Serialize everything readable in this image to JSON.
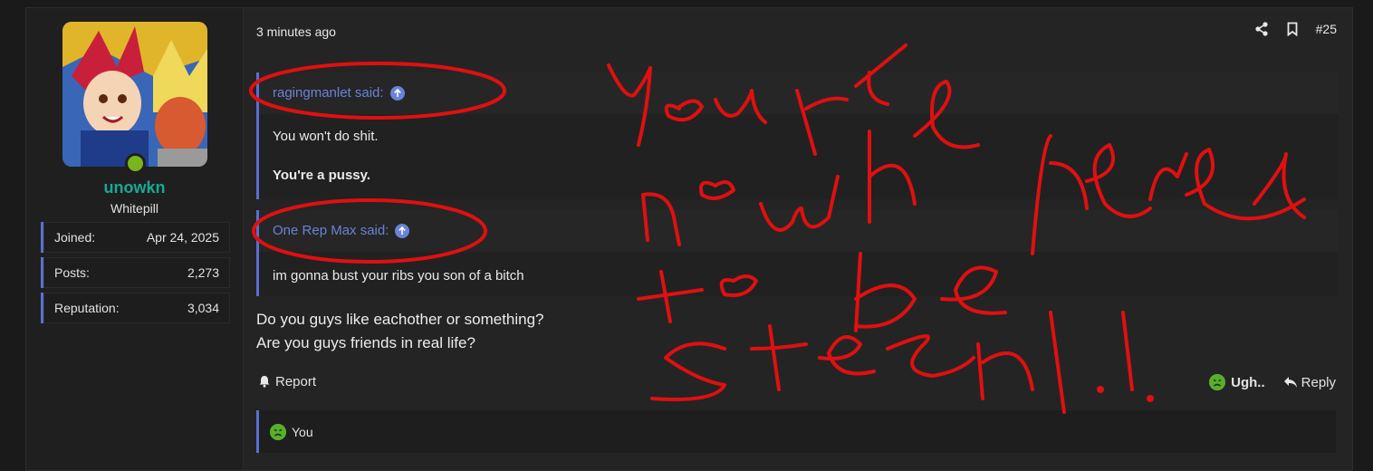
{
  "user": {
    "name": "unowkn",
    "title": "Whitepill",
    "stats": [
      {
        "label": "Joined:",
        "value": "Apr 24, 2025"
      },
      {
        "label": "Posts:",
        "value": "2,273"
      },
      {
        "label": "Reputation:",
        "value": "3,034"
      }
    ]
  },
  "post": {
    "time": "3 minutes ago",
    "number": "#25",
    "quotes": [
      {
        "author": "ragingmanlet said:",
        "lines": [
          "You won't do shit.",
          "You're a pussy."
        ]
      },
      {
        "author": "One Rep Max said:",
        "lines": [
          "im gonna bust your ribs you son of a bitch"
        ]
      }
    ],
    "message": [
      "Do you guys like eachother or something?",
      "Are you guys friends in real life?"
    ],
    "report_label": "Report",
    "reaction_label": "Ugh..",
    "reply_label": "Reply",
    "reactions_summary": "You"
  },
  "colors": {
    "accent": "#5a6fd2",
    "username": "#19a896",
    "online": "#79b51c",
    "annotation": "#e01010"
  },
  "annotation": {
    "handwritten_text": "youre nowhere to be seen!!"
  }
}
